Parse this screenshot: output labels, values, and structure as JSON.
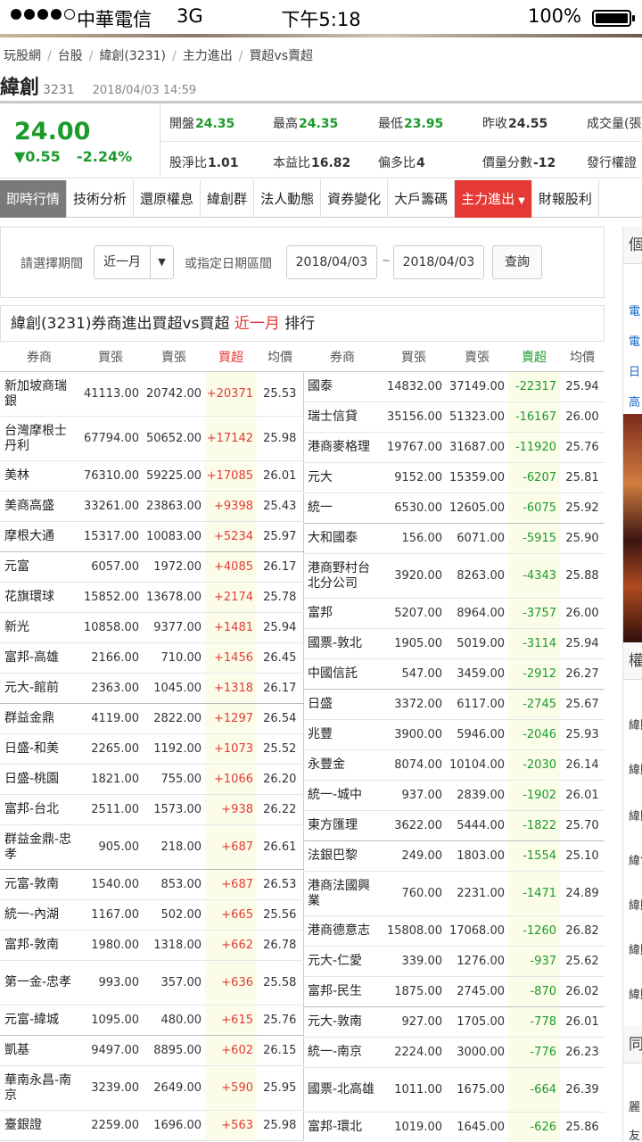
{
  "status_bar": {
    "carrier": "中華電信",
    "network": "3G",
    "time": "下午5:18",
    "battery": "100%"
  },
  "breadcrumb": [
    "玩股網",
    "台股",
    "緯創(3231)",
    "主力進出",
    "買超vs賣超"
  ],
  "stock": {
    "name": "緯創",
    "code": "3231",
    "timestamp": "2018/04/03 14:59"
  },
  "quote": {
    "price": "24.00",
    "change": "▼0.55",
    "change_pct": "-2.24%",
    "stats": [
      {
        "label": "開盤",
        "value": "24.35",
        "color": "green"
      },
      {
        "label": "最高",
        "value": "24.35",
        "color": "green"
      },
      {
        "label": "最低",
        "value": "23.95",
        "color": "green"
      },
      {
        "label": "昨收",
        "value": "24.55",
        "color": "dark"
      },
      {
        "label": "成交量(張",
        "value": "",
        "color": "dark"
      },
      {
        "label": "股淨比",
        "value": "1.01",
        "color": "dark"
      },
      {
        "label": "本益比",
        "value": "16.82",
        "color": "dark"
      },
      {
        "label": "偏多比",
        "value": "4",
        "color": "dark"
      },
      {
        "label": "價量分數",
        "value": "-12",
        "color": "dark"
      },
      {
        "label": "發行權證",
        "value": "",
        "color": "dark"
      }
    ]
  },
  "tabs": [
    "即時行情",
    "技術分析",
    "還原權息",
    "緯創群",
    "法人動態",
    "資券變化",
    "大戶籌碼",
    "主力進出",
    "財報股利"
  ],
  "filter": {
    "period_label": "請選擇期間",
    "period_value": "近一月",
    "range_label": "或指定日期區間",
    "date_from": "2018/04/03",
    "separator": "~",
    "date_to": "2018/04/03",
    "query_button": "查詢"
  },
  "ranking": {
    "title_prefix": "緯創(3231)券商進出買超vs買超",
    "title_period": "近一月",
    "title_suffix": "排行",
    "buy_headers": [
      "券商",
      "買張",
      "賣張",
      "買超",
      "均價"
    ],
    "sell_headers": [
      "券商",
      "買張",
      "賣張",
      "賣超",
      "均價"
    ],
    "buy_rows": [
      [
        "新加坡商瑞銀",
        "41113.00",
        "20742.00",
        "+20371",
        "25.53"
      ],
      [
        "台灣摩根士丹利",
        "67794.00",
        "50652.00",
        "+17142",
        "25.98"
      ],
      [
        "美林",
        "76310.00",
        "59225.00",
        "+17085",
        "26.01"
      ],
      [
        "美商高盛",
        "33261.00",
        "23863.00",
        "+9398",
        "25.43"
      ],
      [
        "摩根大通",
        "15317.00",
        "10083.00",
        "+5234",
        "25.97"
      ],
      [
        "元富",
        "6057.00",
        "1972.00",
        "+4085",
        "26.17"
      ],
      [
        "花旗環球",
        "15852.00",
        "13678.00",
        "+2174",
        "25.78"
      ],
      [
        "新光",
        "10858.00",
        "9377.00",
        "+1481",
        "25.94"
      ],
      [
        "富邦-高雄",
        "2166.00",
        "710.00",
        "+1456",
        "26.45"
      ],
      [
        "元大-館前",
        "2363.00",
        "1045.00",
        "+1318",
        "26.17"
      ],
      [
        "群益金鼎",
        "4119.00",
        "2822.00",
        "+1297",
        "26.54"
      ],
      [
        "日盛-和美",
        "2265.00",
        "1192.00",
        "+1073",
        "25.52"
      ],
      [
        "日盛-桃園",
        "1821.00",
        "755.00",
        "+1066",
        "26.20"
      ],
      [
        "富邦-台北",
        "2511.00",
        "1573.00",
        "+938",
        "26.22"
      ],
      [
        "群益金鼎-忠孝",
        "905.00",
        "218.00",
        "+687",
        "26.61"
      ],
      [
        "元富-敦南",
        "1540.00",
        "853.00",
        "+687",
        "26.53"
      ],
      [
        "統一-內湖",
        "1167.00",
        "502.00",
        "+665",
        "25.56"
      ],
      [
        "富邦-敦南",
        "1980.00",
        "1318.00",
        "+662",
        "26.78"
      ],
      [
        "第一金-忠孝",
        "993.00",
        "357.00",
        "+636",
        "25.58"
      ],
      [
        "元富-緯城",
        "1095.00",
        "480.00",
        "+615",
        "25.76"
      ],
      [
        "凱基",
        "9497.00",
        "8895.00",
        "+602",
        "26.15"
      ],
      [
        "華南永昌-南京",
        "3239.00",
        "2649.00",
        "+590",
        "25.95"
      ],
      [
        "臺銀證",
        "2259.00",
        "1696.00",
        "+563",
        "25.98"
      ]
    ],
    "sell_rows": [
      [
        "國泰",
        "14832.00",
        "37149.00",
        "-22317",
        "25.94"
      ],
      [
        "瑞士信貸",
        "35156.00",
        "51323.00",
        "-16167",
        "26.00"
      ],
      [
        "港商麥格理",
        "19767.00",
        "31687.00",
        "-11920",
        "25.76"
      ],
      [
        "元大",
        "9152.00",
        "15359.00",
        "-6207",
        "25.81"
      ],
      [
        "統一",
        "6530.00",
        "12605.00",
        "-6075",
        "25.92"
      ],
      [
        "大和國泰",
        "156.00",
        "6071.00",
        "-5915",
        "25.90"
      ],
      [
        "港商野村台北分公司",
        "3920.00",
        "8263.00",
        "-4343",
        "25.88"
      ],
      [
        "富邦",
        "5207.00",
        "8964.00",
        "-3757",
        "26.00"
      ],
      [
        "國票-敦北",
        "1905.00",
        "5019.00",
        "-3114",
        "25.94"
      ],
      [
        "中國信託",
        "547.00",
        "3459.00",
        "-2912",
        "26.27"
      ],
      [
        "日盛",
        "3372.00",
        "6117.00",
        "-2745",
        "25.67"
      ],
      [
        "兆豐",
        "3900.00",
        "5946.00",
        "-2046",
        "25.93"
      ],
      [
        "永豐金",
        "8074.00",
        "10104.00",
        "-2030",
        "26.14"
      ],
      [
        "統一-城中",
        "937.00",
        "2839.00",
        "-1902",
        "26.01"
      ],
      [
        "東方匯理",
        "3622.00",
        "5444.00",
        "-1822",
        "25.70"
      ],
      [
        "法銀巴黎",
        "249.00",
        "1803.00",
        "-1554",
        "25.10"
      ],
      [
        "港商法國興業",
        "760.00",
        "2231.00",
        "-1471",
        "24.89"
      ],
      [
        "港商德意志",
        "15808.00",
        "17068.00",
        "-1260",
        "26.82"
      ],
      [
        "元大-仁愛",
        "339.00",
        "1276.00",
        "-937",
        "25.62"
      ],
      [
        "富邦-民生",
        "1875.00",
        "2745.00",
        "-870",
        "26.02"
      ],
      [
        "元大-敦南",
        "927.00",
        "1705.00",
        "-778",
        "26.01"
      ],
      [
        "統一-南京",
        "2224.00",
        "3000.00",
        "-776",
        "26.23"
      ],
      [
        "國票-北高雄",
        "1011.00",
        "1675.00",
        "-664",
        "26.39"
      ],
      [
        "富邦-環北",
        "1019.00",
        "1645.00",
        "-626",
        "25.86"
      ]
    ]
  },
  "sidebar_peek": {
    "head1": "個",
    "links": [
      "電",
      "電",
      "日",
      "高"
    ],
    "head2": "權",
    "items": [
      "緯購",
      "緯購",
      "緯購",
      "緯售",
      "緯購",
      "緯購",
      "緯購"
    ],
    "head3": "同",
    "foot": [
      "麗",
      "友"
    ]
  }
}
